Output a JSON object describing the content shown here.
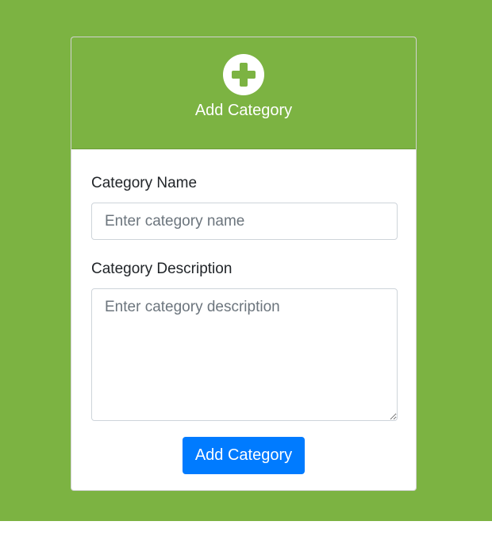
{
  "colors": {
    "background": "#7cb342",
    "header": "#7cb342",
    "icon_plus": "#7cb342",
    "button": "#007bff"
  },
  "header": {
    "icon": "plus-circle-icon",
    "title": "Add Category"
  },
  "form": {
    "name_label": "Category Name",
    "name_placeholder": "Enter category name",
    "name_value": "",
    "description_label": "Category Description",
    "description_placeholder": "Enter category description",
    "description_value": "",
    "submit_label": "Add Category"
  }
}
